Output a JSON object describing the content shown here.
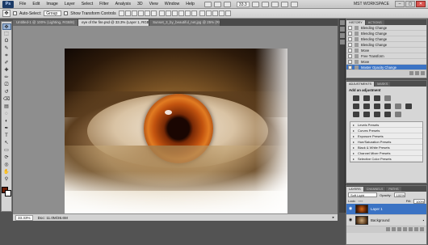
{
  "app": {
    "logo": "Ps",
    "menus": [
      "File",
      "Edit",
      "Image",
      "Layer",
      "Select",
      "Filter",
      "Analysis",
      "3D",
      "View",
      "Window",
      "Help"
    ],
    "zoom_readout": "33.3",
    "workspace": "MST WORKSPACE",
    "window_controls": {
      "minimize": "–",
      "maximize": "▢",
      "close": "✕"
    }
  },
  "options_bar": {
    "auto_select_label": "Auto-Select:",
    "auto_select_value": "Group",
    "show_transform_label": "Show Transform Controls"
  },
  "tools": {
    "icons": [
      "move-tool",
      "marquee-tool",
      "lasso-tool",
      "quick-select-tool",
      "crop-tool",
      "eyedropper-tool",
      "healing-tool",
      "brush-tool",
      "clone-stamp-tool",
      "history-brush-tool",
      "eraser-tool",
      "gradient-tool",
      "blur-tool",
      "dodge-tool",
      "pen-tool",
      "type-tool",
      "path-select-tool",
      "shape-tool",
      "3d-rotate-tool",
      "3d-orbit-tool",
      "hand-tool",
      "zoom-tool"
    ],
    "glyphs": [
      "✥",
      "⬚",
      "ʘ",
      "✎",
      "⌗",
      "✐",
      "✚",
      "✏",
      "⎚",
      "↺",
      "⌫",
      "▤",
      "◌",
      "◐",
      "✒",
      "T",
      "↖",
      "▭",
      "⟳",
      "◎",
      "✋",
      "⚲"
    ],
    "foreground_color": "#6b1d04",
    "background_color": "#ffffff"
  },
  "documents": {
    "tabs": [
      {
        "label": "Untitled-1 @ 100% (Lighting, RGB/8)",
        "active": false
      },
      {
        "label": "eye of the fire.psd @ 33.3% (Layer 1, RGB/8)",
        "active": true
      },
      {
        "label": "Sunset_3_by_beautiful_net.jpg @ 25% (RGB/8)",
        "active": false
      }
    ]
  },
  "status": {
    "zoom": "33.33%",
    "doc": "Doc: 11.0M/36.6M"
  },
  "panels": {
    "history": {
      "tabs": [
        "HISTORY",
        "ACTIONS"
      ],
      "items": [
        {
          "label": "Blending Change",
          "selected": false
        },
        {
          "label": "Blending Change",
          "selected": false
        },
        {
          "label": "Blending Change",
          "selected": false
        },
        {
          "label": "Blending Change",
          "selected": false
        },
        {
          "label": "Move",
          "selected": false
        },
        {
          "label": "Free Transform",
          "selected": false
        },
        {
          "label": "Move",
          "selected": false
        },
        {
          "label": "Master Opacity Change",
          "selected": true
        }
      ]
    },
    "adjustments": {
      "tabs": [
        "ADJUSTMENTS",
        "MASKS"
      ],
      "title": "Add an adjustment",
      "presets": [
        "Levels Presets",
        "Curves Presets",
        "Exposure Presets",
        "Hue/Saturation Presets",
        "Black & White Presets",
        "Channel Mixer Presets",
        "Selective Color Presets"
      ]
    },
    "layers": {
      "tabs": [
        "LAYERS",
        "CHANNELS",
        "PATHS"
      ],
      "blend_mode": "Soft Light",
      "opacity_label": "Opacity:",
      "opacity_value": "100%",
      "lock_label": "Lock:",
      "fill_label": "Fill:",
      "fill_value": "100%",
      "items": [
        {
          "name": "Layer 1",
          "selected": true
        },
        {
          "name": "Background",
          "selected": false
        }
      ]
    }
  }
}
